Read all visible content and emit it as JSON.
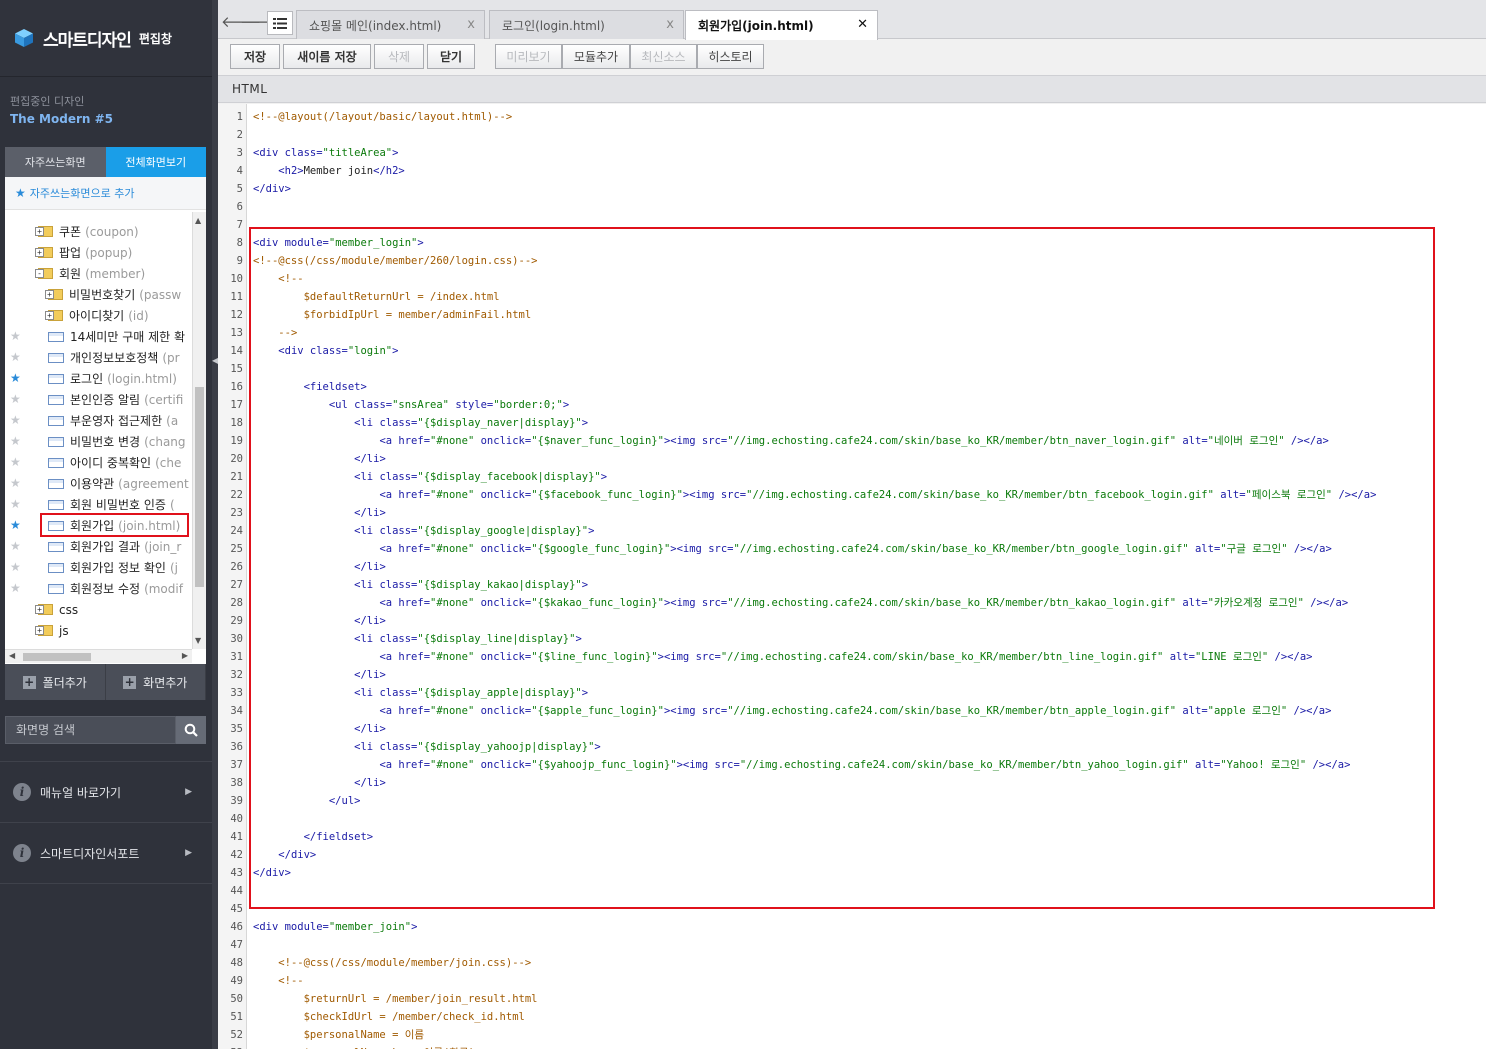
{
  "sidebar": {
    "app_title": "스마트디자인",
    "app_subtitle": "편집창",
    "editing_label": "편집중인 디자인",
    "editing_name": "The Modern #5",
    "tabs": [
      "자주쓰는화면",
      "전체화면보기"
    ],
    "active_tab": 1,
    "add_favorite": "자주쓰는화면으로 추가",
    "tree": [
      {
        "label": "쿠폰",
        "path": "(coupon)",
        "type": "folder",
        "depth": 0,
        "star": false,
        "expanded": false
      },
      {
        "label": "팝업",
        "path": "(popup)",
        "type": "folder",
        "depth": 0,
        "star": false,
        "expanded": false
      },
      {
        "label": "회원",
        "path": "(member)",
        "type": "folder",
        "depth": 0,
        "star": false,
        "expanded": true
      },
      {
        "label": "비밀번호찾기",
        "path": "(passw",
        "type": "folder",
        "depth": 1,
        "star": false,
        "expanded": false
      },
      {
        "label": "아이디찾기",
        "path": "(id)",
        "type": "folder",
        "depth": 1,
        "star": false,
        "expanded": false
      },
      {
        "label": "14세미만 구매 제한 확",
        "path": "",
        "type": "page",
        "depth": 1,
        "star": true,
        "starred": false
      },
      {
        "label": "개인정보보호정책",
        "path": "(pr",
        "type": "page",
        "depth": 1,
        "star": true,
        "starred": false
      },
      {
        "label": "로그인",
        "path": "(login.html)",
        "type": "page",
        "depth": 1,
        "star": true,
        "starred": true
      },
      {
        "label": "본인인증 알림",
        "path": "(certifi",
        "type": "page",
        "depth": 1,
        "star": true,
        "starred": false
      },
      {
        "label": "부운영자 접근제한",
        "path": "(a",
        "type": "page",
        "depth": 1,
        "star": true,
        "starred": false
      },
      {
        "label": "비밀번호 변경",
        "path": "(chang",
        "type": "page",
        "depth": 1,
        "star": true,
        "starred": false
      },
      {
        "label": "아이디 중복확인",
        "path": "(che",
        "type": "page",
        "depth": 1,
        "star": true,
        "starred": false
      },
      {
        "label": "이용약관",
        "path": "(agreement",
        "type": "page",
        "depth": 1,
        "star": true,
        "starred": false
      },
      {
        "label": "회원 비밀번호 인증",
        "path": "(",
        "type": "page",
        "depth": 1,
        "star": true,
        "starred": false
      },
      {
        "label": "회원가입",
        "path": "(join.html)",
        "type": "page",
        "depth": 1,
        "star": true,
        "starred": true
      },
      {
        "label": "회원가입 결과",
        "path": "(join_r",
        "type": "page",
        "depth": 1,
        "star": true,
        "starred": false
      },
      {
        "label": "회원가입 정보 확인",
        "path": "(j",
        "type": "page",
        "depth": 1,
        "star": true,
        "starred": false
      },
      {
        "label": "회원정보 수정",
        "path": "(modif",
        "type": "page",
        "depth": 1,
        "star": true,
        "starred": false
      },
      {
        "label": "css",
        "path": "",
        "type": "folder",
        "depth": 0,
        "star": false,
        "expanded": false
      },
      {
        "label": "js",
        "path": "",
        "type": "folder",
        "depth": 0,
        "star": false,
        "expanded": false
      }
    ],
    "add_folder": "폴더추가",
    "add_screen": "화면추가",
    "search_placeholder": "화면명 검색",
    "links": [
      "매뉴얼 바로가기",
      "스마트디자인서포트"
    ]
  },
  "tabs": [
    {
      "label": "쇼핑몰 메인(index.html)",
      "active": false
    },
    {
      "label": "로그인(login.html)",
      "active": false
    },
    {
      "label": "회원가입(join.html)",
      "active": true
    }
  ],
  "toolbar": {
    "save": "저장",
    "save_as": "새이름 저장",
    "delete": "삭제",
    "close": "닫기",
    "preview": "미리보기",
    "add_module": "모듈추가",
    "latest_source": "최신소스",
    "history": "히스토리"
  },
  "section_label": "HTML",
  "code_lines": [
    [
      [
        "c",
        "<!--@layout(/layout/basic/layout.html)-->"
      ]
    ],
    [],
    [
      [
        "t",
        "<div "
      ],
      [
        "a",
        "class="
      ],
      [
        "v",
        "\"titleArea\""
      ],
      [
        "t",
        ">"
      ]
    ],
    [
      [
        "x",
        "    "
      ],
      [
        "t",
        "<h2>"
      ],
      [
        "x",
        "Member join"
      ],
      [
        "t",
        "</h2>"
      ]
    ],
    [
      [
        "t",
        "</div>"
      ]
    ],
    [],
    [],
    [
      [
        "t",
        "<div "
      ],
      [
        "a",
        "module="
      ],
      [
        "v",
        "\"member_login\""
      ],
      [
        "t",
        ">"
      ]
    ],
    [
      [
        "c",
        "<!--@css(/css/module/member/260/login.css)-->"
      ]
    ],
    [
      [
        "x",
        "    "
      ],
      [
        "c",
        "<!--"
      ]
    ],
    [
      [
        "x",
        "        "
      ],
      [
        "c",
        "$defaultReturnUrl = /index.html"
      ]
    ],
    [
      [
        "x",
        "        "
      ],
      [
        "c",
        "$forbidIpUrl = member/adminFail.html"
      ]
    ],
    [
      [
        "x",
        "    "
      ],
      [
        "c",
        "-->"
      ]
    ],
    [
      [
        "x",
        "    "
      ],
      [
        "t",
        "<div "
      ],
      [
        "a",
        "class="
      ],
      [
        "v",
        "\"login\""
      ],
      [
        "t",
        ">"
      ]
    ],
    [],
    [
      [
        "x",
        "        "
      ],
      [
        "t",
        "<fieldset>"
      ]
    ],
    [
      [
        "x",
        "            "
      ],
      [
        "t",
        "<ul "
      ],
      [
        "a",
        "class="
      ],
      [
        "v",
        "\"snsArea\""
      ],
      [
        "a",
        " style="
      ],
      [
        "v",
        "\"border:0;\""
      ],
      [
        "t",
        ">"
      ]
    ],
    [
      [
        "x",
        "                "
      ],
      [
        "t",
        "<li "
      ],
      [
        "a",
        "class="
      ],
      [
        "v",
        "\"{$display_naver|display}\""
      ],
      [
        "t",
        ">"
      ]
    ],
    [
      [
        "x",
        "                    "
      ],
      [
        "t",
        "<a "
      ],
      [
        "a",
        "href="
      ],
      [
        "v",
        "\"#none\""
      ],
      [
        "a",
        " onclick="
      ],
      [
        "v",
        "\"{$naver_func_login}\""
      ],
      [
        "t",
        "><img "
      ],
      [
        "a",
        "src="
      ],
      [
        "v",
        "\"//img.echosting.cafe24.com/skin/base_ko_KR/member/btn_naver_login.gif\""
      ],
      [
        "a",
        " alt="
      ],
      [
        "v",
        "\"네이버 로그인\""
      ],
      [
        "t",
        " /></a>"
      ]
    ],
    [
      [
        "x",
        "                "
      ],
      [
        "t",
        "</li>"
      ]
    ],
    [
      [
        "x",
        "                "
      ],
      [
        "t",
        "<li "
      ],
      [
        "a",
        "class="
      ],
      [
        "v",
        "\"{$display_facebook|display}\""
      ],
      [
        "t",
        ">"
      ]
    ],
    [
      [
        "x",
        "                    "
      ],
      [
        "t",
        "<a "
      ],
      [
        "a",
        "href="
      ],
      [
        "v",
        "\"#none\""
      ],
      [
        "a",
        " onclick="
      ],
      [
        "v",
        "\"{$facebook_func_login}\""
      ],
      [
        "t",
        "><img "
      ],
      [
        "a",
        "src="
      ],
      [
        "v",
        "\"//img.echosting.cafe24.com/skin/base_ko_KR/member/btn_facebook_login.gif\""
      ],
      [
        "a",
        " alt="
      ],
      [
        "v",
        "\"페이스북 로그인\""
      ],
      [
        "t",
        " /></a>"
      ]
    ],
    [
      [
        "x",
        "                "
      ],
      [
        "t",
        "</li>"
      ]
    ],
    [
      [
        "x",
        "                "
      ],
      [
        "t",
        "<li "
      ],
      [
        "a",
        "class="
      ],
      [
        "v",
        "\"{$display_google|display}\""
      ],
      [
        "t",
        ">"
      ]
    ],
    [
      [
        "x",
        "                    "
      ],
      [
        "t",
        "<a "
      ],
      [
        "a",
        "href="
      ],
      [
        "v",
        "\"#none\""
      ],
      [
        "a",
        " onclick="
      ],
      [
        "v",
        "\"{$google_func_login}\""
      ],
      [
        "t",
        "><img "
      ],
      [
        "a",
        "src="
      ],
      [
        "v",
        "\"//img.echosting.cafe24.com/skin/base_ko_KR/member/btn_google_login.gif\""
      ],
      [
        "a",
        " alt="
      ],
      [
        "v",
        "\"구글 로그인\""
      ],
      [
        "t",
        " /></a>"
      ]
    ],
    [
      [
        "x",
        "                "
      ],
      [
        "t",
        "</li>"
      ]
    ],
    [
      [
        "x",
        "                "
      ],
      [
        "t",
        "<li "
      ],
      [
        "a",
        "class="
      ],
      [
        "v",
        "\"{$display_kakao|display}\""
      ],
      [
        "t",
        ">"
      ]
    ],
    [
      [
        "x",
        "                    "
      ],
      [
        "t",
        "<a "
      ],
      [
        "a",
        "href="
      ],
      [
        "v",
        "\"#none\""
      ],
      [
        "a",
        " onclick="
      ],
      [
        "v",
        "\"{$kakao_func_login}\""
      ],
      [
        "t",
        "><img "
      ],
      [
        "a",
        "src="
      ],
      [
        "v",
        "\"//img.echosting.cafe24.com/skin/base_ko_KR/member/btn_kakao_login.gif\""
      ],
      [
        "a",
        " alt="
      ],
      [
        "v",
        "\"카카오계정 로그인\""
      ],
      [
        "t",
        " /></a>"
      ]
    ],
    [
      [
        "x",
        "                "
      ],
      [
        "t",
        "</li>"
      ]
    ],
    [
      [
        "x",
        "                "
      ],
      [
        "t",
        "<li "
      ],
      [
        "a",
        "class="
      ],
      [
        "v",
        "\"{$display_line|display}\""
      ],
      [
        "t",
        ">"
      ]
    ],
    [
      [
        "x",
        "                    "
      ],
      [
        "t",
        "<a "
      ],
      [
        "a",
        "href="
      ],
      [
        "v",
        "\"#none\""
      ],
      [
        "a",
        " onclick="
      ],
      [
        "v",
        "\"{$line_func_login}\""
      ],
      [
        "t",
        "><img "
      ],
      [
        "a",
        "src="
      ],
      [
        "v",
        "\"//img.echosting.cafe24.com/skin/base_ko_KR/member/btn_line_login.gif\""
      ],
      [
        "a",
        " alt="
      ],
      [
        "v",
        "\"LINE 로그인\""
      ],
      [
        "t",
        " /></a>"
      ]
    ],
    [
      [
        "x",
        "                "
      ],
      [
        "t",
        "</li>"
      ]
    ],
    [
      [
        "x",
        "                "
      ],
      [
        "t",
        "<li "
      ],
      [
        "a",
        "class="
      ],
      [
        "v",
        "\"{$display_apple|display}\""
      ],
      [
        "t",
        ">"
      ]
    ],
    [
      [
        "x",
        "                    "
      ],
      [
        "t",
        "<a "
      ],
      [
        "a",
        "href="
      ],
      [
        "v",
        "\"#none\""
      ],
      [
        "a",
        " onclick="
      ],
      [
        "v",
        "\"{$apple_func_login}\""
      ],
      [
        "t",
        "><img "
      ],
      [
        "a",
        "src="
      ],
      [
        "v",
        "\"//img.echosting.cafe24.com/skin/base_ko_KR/member/btn_apple_login.gif\""
      ],
      [
        "a",
        " alt="
      ],
      [
        "v",
        "\"apple 로그인\""
      ],
      [
        "t",
        " /></a>"
      ]
    ],
    [
      [
        "x",
        "                "
      ],
      [
        "t",
        "</li>"
      ]
    ],
    [
      [
        "x",
        "                "
      ],
      [
        "t",
        "<li "
      ],
      [
        "a",
        "class="
      ],
      [
        "v",
        "\"{$display_yahoojp|display}\""
      ],
      [
        "t",
        ">"
      ]
    ],
    [
      [
        "x",
        "                    "
      ],
      [
        "t",
        "<a "
      ],
      [
        "a",
        "href="
      ],
      [
        "v",
        "\"#none\""
      ],
      [
        "a",
        " onclick="
      ],
      [
        "v",
        "\"{$yahoojp_func_login}\""
      ],
      [
        "t",
        "><img "
      ],
      [
        "a",
        "src="
      ],
      [
        "v",
        "\"//img.echosting.cafe24.com/skin/base_ko_KR/member/btn_yahoo_login.gif\""
      ],
      [
        "a",
        " alt="
      ],
      [
        "v",
        "\"Yahoo! 로그인\""
      ],
      [
        "t",
        " /></a>"
      ]
    ],
    [
      [
        "x",
        "                "
      ],
      [
        "t",
        "</li>"
      ]
    ],
    [
      [
        "x",
        "            "
      ],
      [
        "t",
        "</ul>"
      ]
    ],
    [],
    [
      [
        "x",
        "        "
      ],
      [
        "t",
        "</fieldset>"
      ]
    ],
    [
      [
        "x",
        "    "
      ],
      [
        "t",
        "</div>"
      ]
    ],
    [
      [
        "t",
        "</div>"
      ]
    ],
    [],
    [],
    [
      [
        "t",
        "<div "
      ],
      [
        "a",
        "module="
      ],
      [
        "v",
        "\"member_join\""
      ],
      [
        "t",
        ">"
      ]
    ],
    [],
    [
      [
        "x",
        "    "
      ],
      [
        "c",
        "<!--@css(/css/module/member/join.css)-->"
      ]
    ],
    [
      [
        "x",
        "    "
      ],
      [
        "c",
        "<!--"
      ]
    ],
    [
      [
        "x",
        "        "
      ],
      [
        "c",
        "$returnUrl = /member/join_result.html"
      ]
    ],
    [
      [
        "x",
        "        "
      ],
      [
        "c",
        "$checkIdUrl = /member/check_id.html"
      ]
    ],
    [
      [
        "x",
        "        "
      ],
      [
        "c",
        "$personalName = 이름"
      ]
    ],
    [
      [
        "x",
        "        "
      ],
      [
        "c",
        "$personalName_ko = 이름(한글)"
      ]
    ]
  ]
}
